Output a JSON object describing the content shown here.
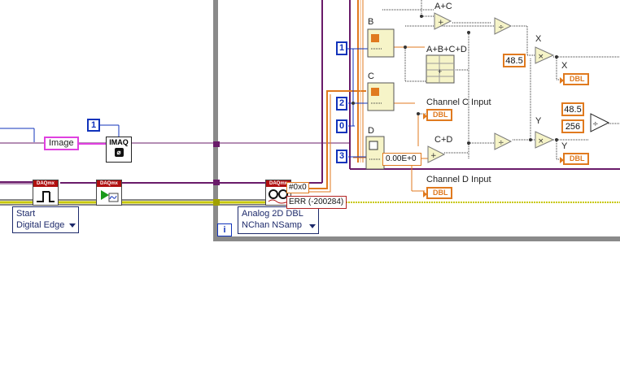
{
  "imaq": {
    "image_string": "Image",
    "index_constant": "1",
    "node_label": "IMAQ"
  },
  "daqmx": {
    "header": "DAQmx",
    "trigger_selector": "Start\nDigital Edge",
    "trigger_line1": "Start",
    "trigger_line2": "Digital Edge",
    "read_selector_line1": "Analog 2D DBL",
    "read_selector_line2": "NChan NSamp"
  },
  "loop": {
    "iteration_terminal": "i"
  },
  "error": {
    "status_code": "#0x0",
    "error_text": "ERR (-200284)"
  },
  "index_constants": [
    "1",
    "2",
    "0",
    "3"
  ],
  "channels": {
    "b_label": "B",
    "c_label": "C",
    "d_label": "D"
  },
  "math": {
    "a_plus_c": "A+C",
    "a_b_c_d": "A+B+C+D",
    "c_plus_d": "C+D",
    "x_label": "X",
    "y_label": "Y",
    "x_ind_label": "X",
    "y_ind_label": "Y",
    "const_48_5_a": "48.5",
    "const_48_5_b": "48.5",
    "const_256": "256",
    "zero_display": "0.00E+0"
  },
  "indicators": {
    "dbl": "DBL",
    "channel_c_input": "Channel C Input",
    "channel_d_input": "Channel D Input"
  },
  "colors": {
    "error_cluster": "#c8c800",
    "refnum": "#6a1b6a",
    "dbl_wire": "#e07a1f",
    "int_wire": "#1133bb",
    "loop_border": "#8a8a8a",
    "string": "#e040e0"
  }
}
